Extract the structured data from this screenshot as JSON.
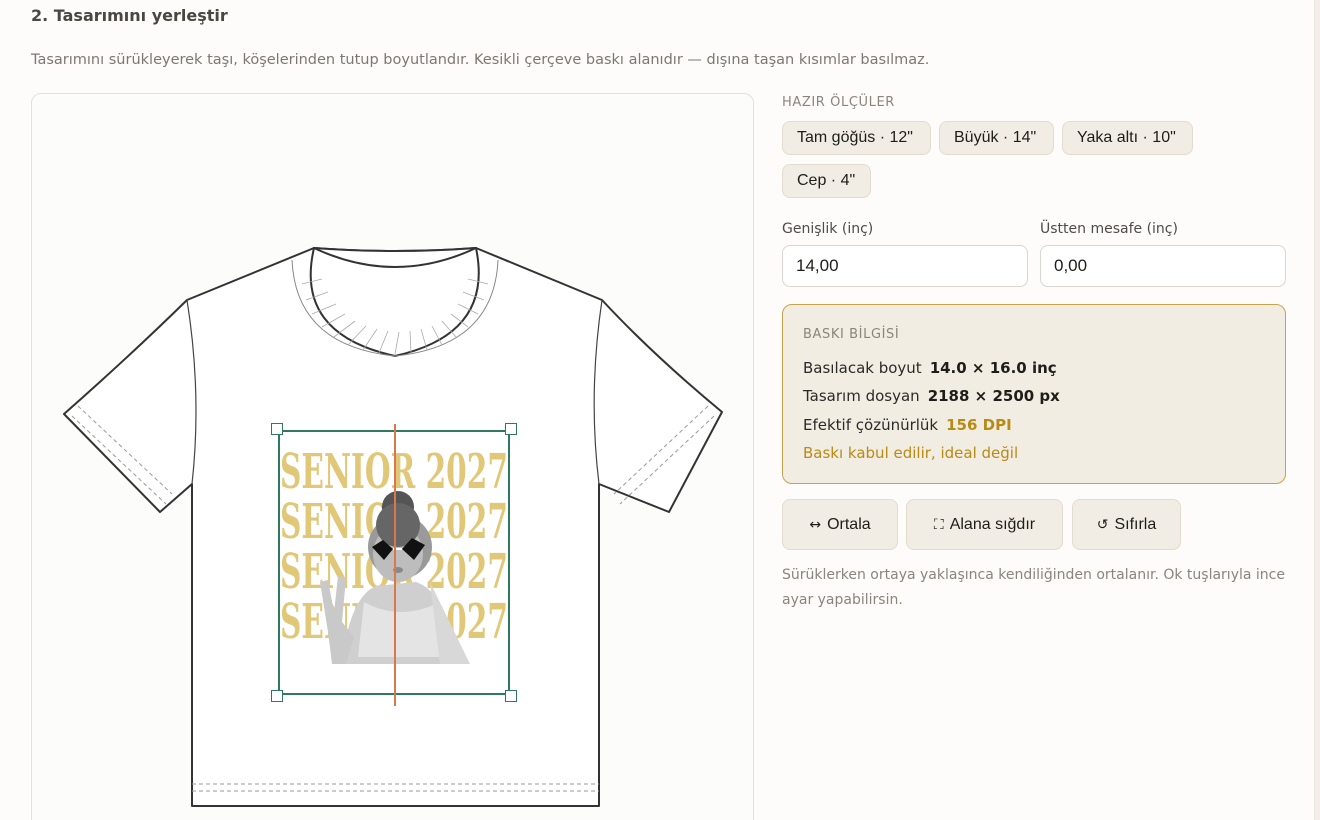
{
  "section": {
    "title": "2. Tasarımını yerleştir",
    "description": "Tasarımını sürükleyerek taşı, köşelerinden tutup boyutlandır. Kesikli çerçeve baskı alanıdır — dışına taşan kısımlar basılmaz."
  },
  "design": {
    "text_line": "SENIOR 2027",
    "text_color": "#e0c878"
  },
  "presets": {
    "label": "HAZIR ÖLÇÜLER",
    "items": [
      {
        "label": "Tam göğüs · 12\""
      },
      {
        "label": "Büyük · 14\""
      },
      {
        "label": "Yaka altı · 10\""
      },
      {
        "label": "Cep · 4\""
      }
    ]
  },
  "fields": {
    "width_label": "Genişlik (inç)",
    "width_value": "14,00",
    "top_label": "Üstten mesafe (inç)",
    "top_value": "0,00"
  },
  "print_info": {
    "title": "BASKI BİLGİSİ",
    "rows": [
      {
        "label": "Basılacak boyut",
        "value": "14.0 × 16.0 inç"
      },
      {
        "label": "Tasarım dosyan",
        "value": "2188 × 2500 px"
      },
      {
        "label": "Efektif çözünürlük",
        "value": "156 DPI"
      }
    ],
    "note": "Baskı kabul edilir, ideal değil"
  },
  "actions": {
    "center": {
      "icon": "↔",
      "label": "Ortala"
    },
    "fit": {
      "icon": "⛶",
      "label": "Alana sığdır"
    },
    "reset": {
      "icon": "↺",
      "label": "Sıfırla"
    }
  },
  "hint": "Sürüklerken ortaya yaklaşınca kendiliğinden ortalanır. Ok tuşlarıyla ince ayar yapabilirsin.",
  "colors": {
    "accent_green": "#2f7a5f",
    "guide_orange": "#d9784a",
    "warning_gold": "#b88a16"
  }
}
